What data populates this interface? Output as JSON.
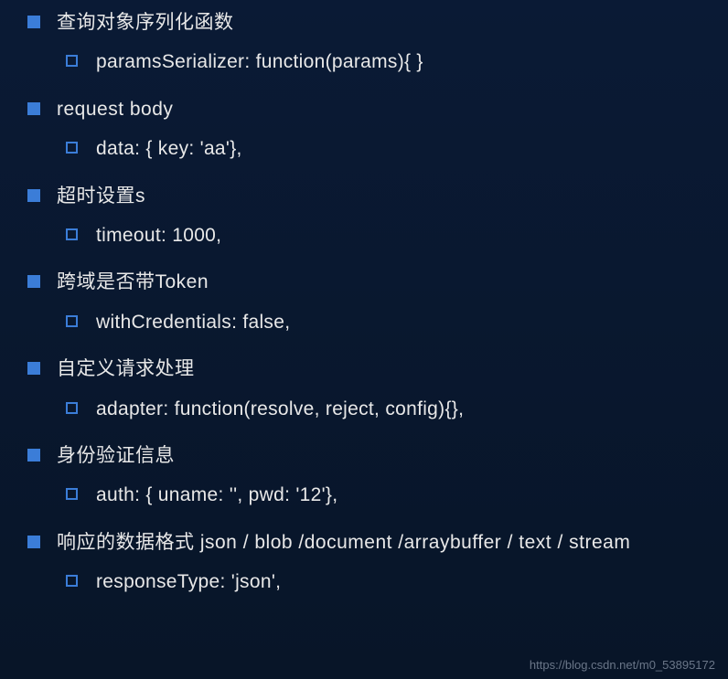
{
  "items": [
    {
      "label": "查询对象序列化函数",
      "sub": "paramsSerializer: function(params){ }"
    },
    {
      "label": "request body",
      "sub": "data: { key: 'aa'},"
    },
    {
      "label": "超时设置s",
      "sub": "timeout: 1000,"
    },
    {
      "label": "跨域是否带Token",
      "sub": "withCredentials: false,"
    },
    {
      "label": "自定义请求处理",
      "sub": "adapter: function(resolve, reject, config){},"
    },
    {
      "label": "身份验证信息",
      "sub": "auth: { uname: '', pwd: '12'},"
    },
    {
      "label": "响应的数据格式 json / blob /document /arraybuffer / text / stream",
      "sub": "responseType: 'json',"
    }
  ],
  "watermark": "https://blog.csdn.net/m0_53895172"
}
